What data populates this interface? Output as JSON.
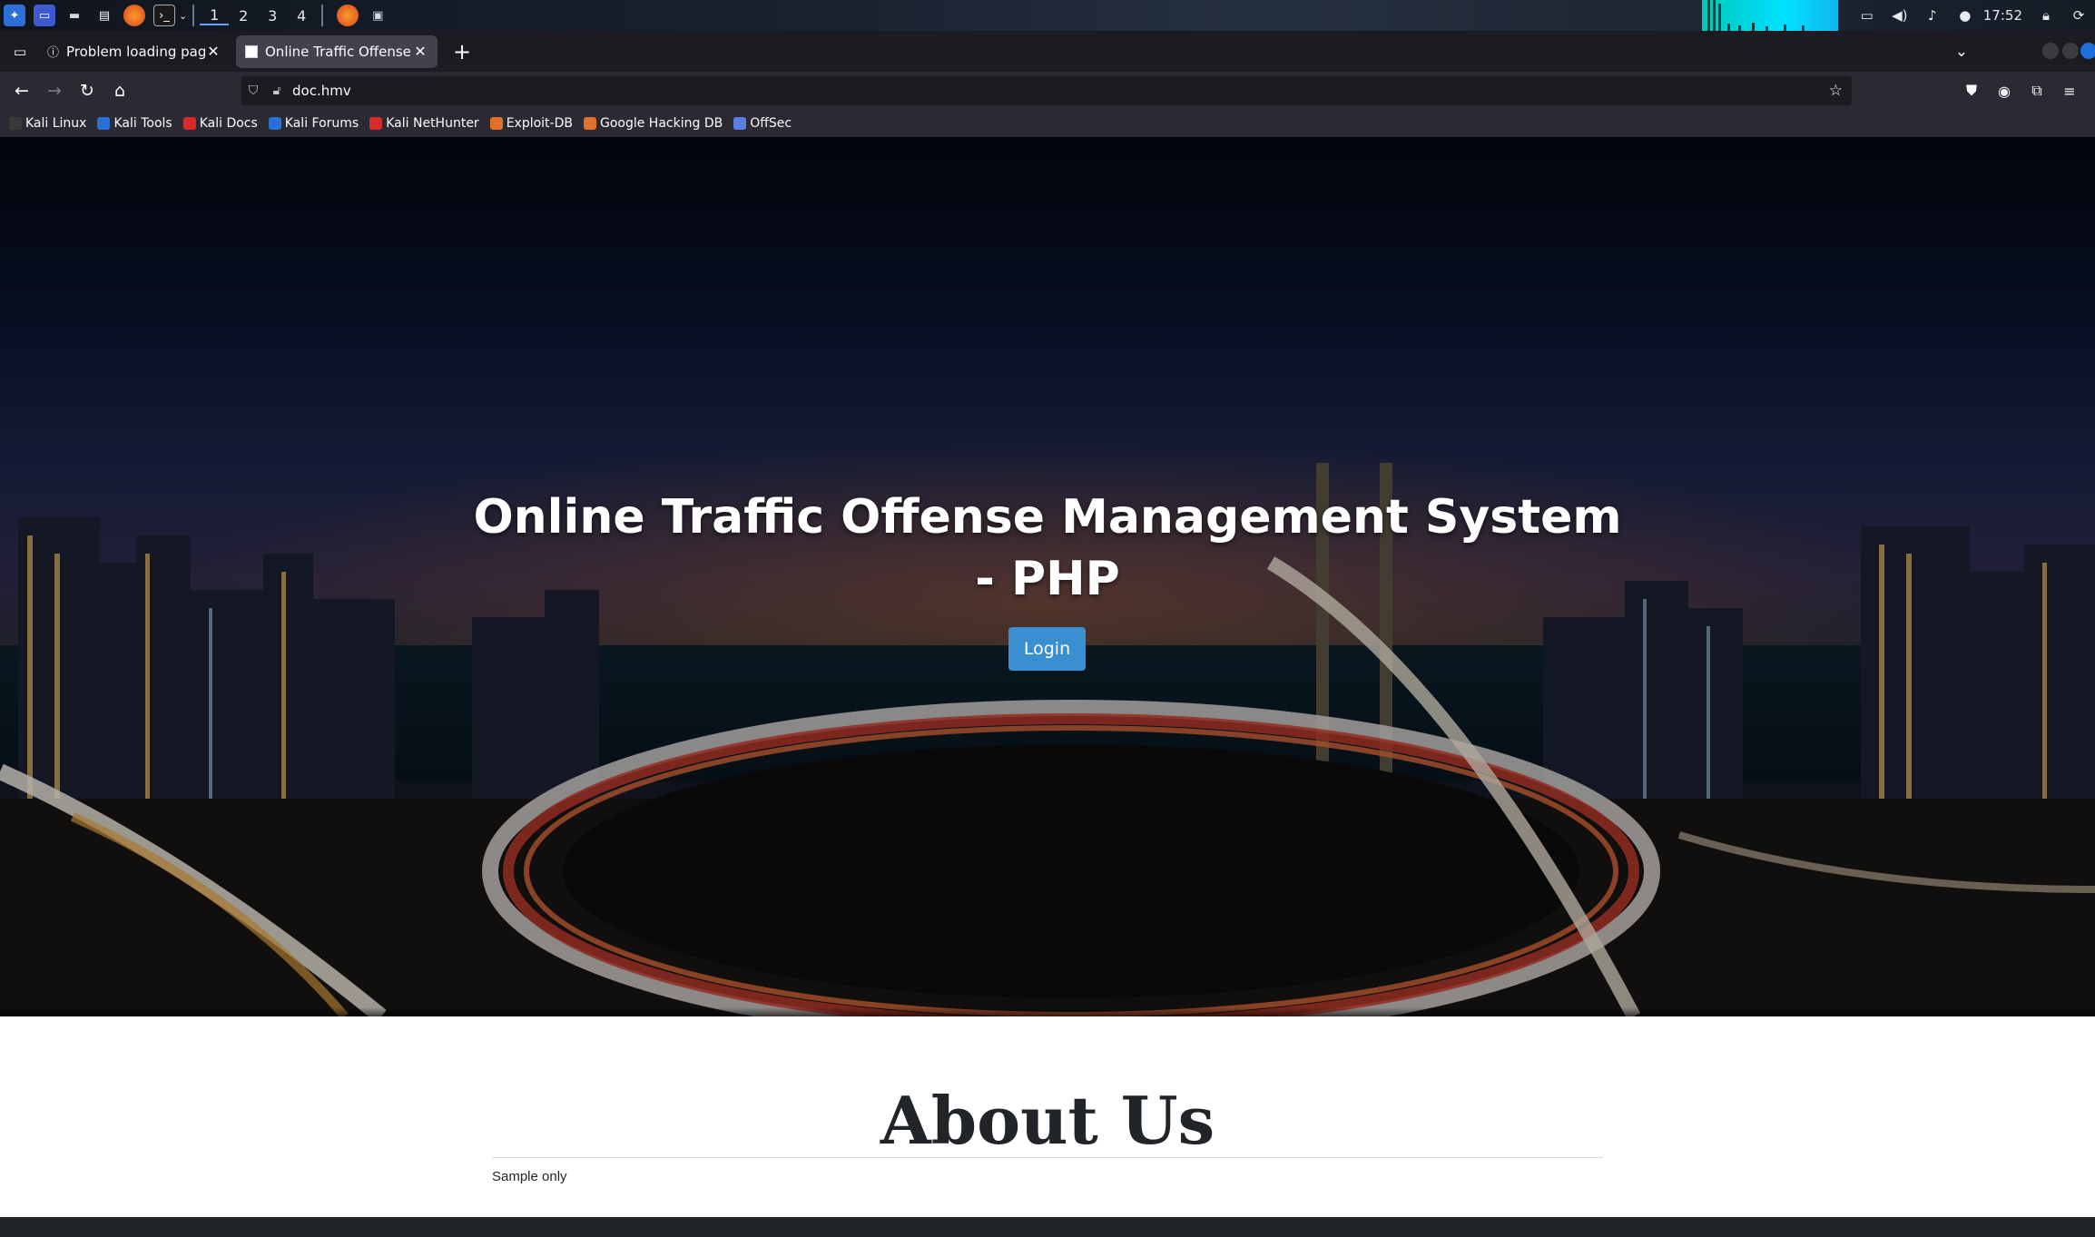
{
  "taskbar": {
    "workspaces": [
      "1",
      "2",
      "3",
      "4"
    ],
    "active_workspace": "1",
    "clock": "17:52",
    "apps": [
      "kali-menu-icon",
      "desktop-icon",
      "files-icon",
      "text-editor-icon",
      "firefox-icon",
      "terminal-icon"
    ],
    "tray": [
      "display-icon",
      "volume-icon",
      "bell-icon",
      "power-icon",
      "lock-icon",
      "logout-icon"
    ]
  },
  "browser": {
    "tabs": [
      {
        "title": "Problem loading page",
        "active": false
      },
      {
        "title": "Online Traffic Offense Ma",
        "active": true
      }
    ],
    "url": "doc.hmv",
    "bookmarks": [
      {
        "label": "Kali Linux",
        "color": "#3a3a3a"
      },
      {
        "label": "Kali Tools",
        "color": "#2a6fd6"
      },
      {
        "label": "Kali Docs",
        "color": "#d52b2b"
      },
      {
        "label": "Kali Forums",
        "color": "#2a6fd6"
      },
      {
        "label": "Kali NetHunter",
        "color": "#d52b2b"
      },
      {
        "label": "Exploit-DB",
        "color": "#e0702a"
      },
      {
        "label": "Google Hacking DB",
        "color": "#e0702a"
      },
      {
        "label": "OffSec",
        "color": "#5a7de0"
      }
    ]
  },
  "page": {
    "hero_title": "Online Traffic Offense Management System - PHP",
    "login_label": "Login",
    "about_title": "About Us",
    "about_text": "Sample only"
  },
  "colors": {
    "login_button": "#3a8fd0",
    "tab_active": "#42414d",
    "toolbar": "#2b2a33",
    "footer": "#212529"
  }
}
